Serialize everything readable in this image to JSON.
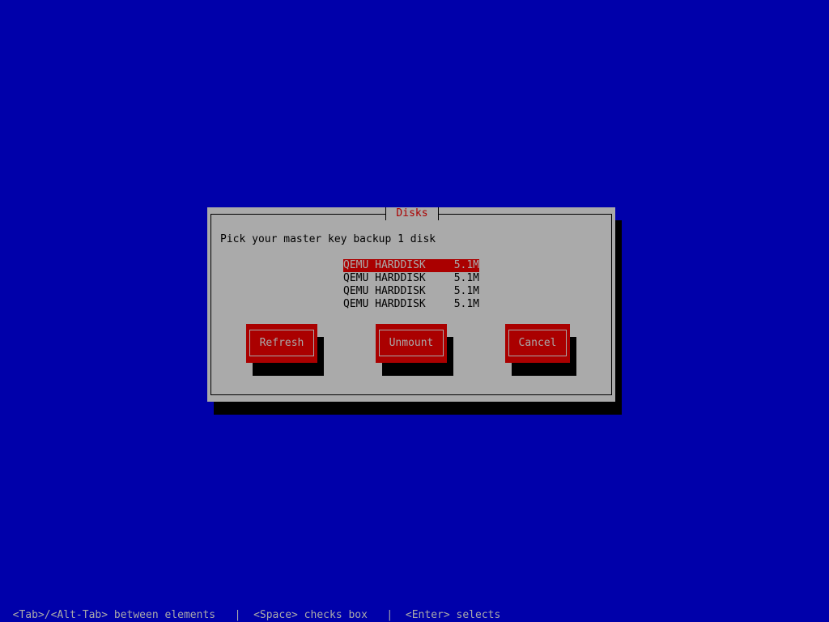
{
  "dialog": {
    "title": "Disks",
    "prompt": "Pick your master key backup 1 disk",
    "disks": [
      {
        "name": "QEMU HARDDISK",
        "size": "5.1M",
        "selected": true
      },
      {
        "name": "QEMU HARDDISK",
        "size": "5.1M",
        "selected": false
      },
      {
        "name": "QEMU HARDDISK",
        "size": "5.1M",
        "selected": false
      },
      {
        "name": "QEMU HARDDISK",
        "size": "5.1M",
        "selected": false
      }
    ],
    "buttons": {
      "refresh": "Refresh",
      "unmount": "Unmount",
      "cancel": "Cancel"
    }
  },
  "help_line": "  <Tab>/<Alt-Tab> between elements   |  <Space> checks box   |  <Enter> selects",
  "colors": {
    "background": "#0000aa",
    "dialog": "#aaaaaa",
    "accent": "#aa0000",
    "shadow": "#000000"
  }
}
